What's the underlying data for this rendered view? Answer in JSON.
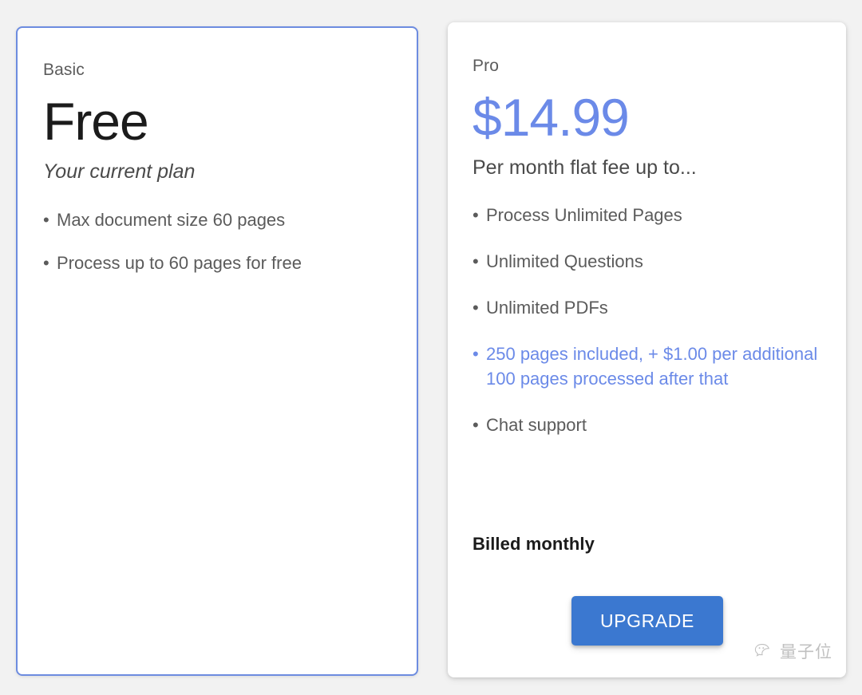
{
  "background_color": "#f2f2f2",
  "accent_blue": "#6b8ae8",
  "button_blue": "#3b78d0",
  "border_blue": "#6d8ce0",
  "plans": {
    "basic": {
      "name": "Basic",
      "price": "Free",
      "subtitle": "Your current plan",
      "features": [
        {
          "bullet": "•",
          "text": "Max document size 60 pages",
          "highlight": false
        },
        {
          "bullet": "•",
          "text": "Process up to 60 pages for free",
          "highlight": false
        }
      ]
    },
    "pro": {
      "name": "Pro",
      "price": "$14.99",
      "subtitle": "Per month flat fee up to...",
      "features": [
        {
          "bullet": "•",
          "text": "Process Unlimited Pages",
          "highlight": false
        },
        {
          "bullet": "•",
          "text": "Unlimited Questions",
          "highlight": false
        },
        {
          "bullet": "•",
          "text": "Unlimited PDFs",
          "highlight": false
        },
        {
          "bullet": "•",
          "text": "250 pages included, + $1.00 per additional 100 pages processed after that",
          "highlight": true
        },
        {
          "bullet": "•",
          "text": "Chat support",
          "highlight": false
        }
      ],
      "billing_note": "Billed monthly",
      "cta_label": "UPGRADE"
    }
  },
  "watermark": {
    "icon": "wechat-logo-icon",
    "text": "量子位"
  }
}
